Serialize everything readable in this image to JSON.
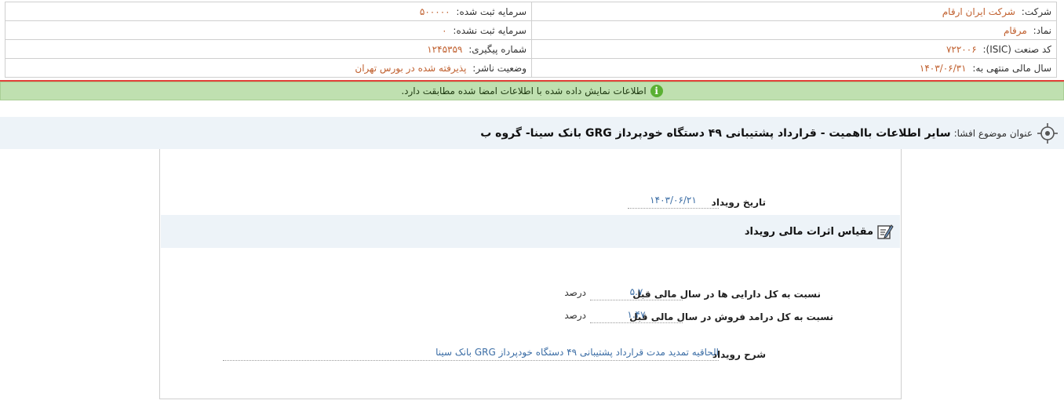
{
  "company_info": {
    "rows": [
      {
        "left_label": "سرمایه ثبت شده:",
        "left_value": "۵۰۰۰۰۰",
        "right_label": "شرکت:",
        "right_value": "شرکت ایران ارقام"
      },
      {
        "left_label": "سرمایه ثبت نشده:",
        "left_value": "۰",
        "right_label": "نماد:",
        "right_value": "مرقام"
      },
      {
        "left_label": "شماره پیگیری:",
        "left_value": "۱۲۴۵۳۵۹",
        "right_label": "کد صنعت (ISIC):",
        "right_value": "۷۲۲۰۰۶"
      },
      {
        "left_label": "وضعیت ناشر:",
        "left_value": "پذیرفته شده در بورس تهران",
        "right_label": "سال مالی منتهی به:",
        "right_value": "۱۴۰۳/۰۶/۳۱"
      }
    ]
  },
  "banner": {
    "text": "اطلاعات نمایش داده شده با اطلاعات امضا شده مطابقت دارد.",
    "icon_glyph": "i",
    "icon": "info-icon",
    "color": "#bfe0b0"
  },
  "title": {
    "label": "عنوان موضوع افشا:",
    "value": "سایر اطلاعات بااهمیت - قرارداد پشتیبانی ۴۹ دستگاه خودپرداز GRG بانک سینا- گروه ب",
    "icon": "target-icon"
  },
  "event": {
    "date_label": "تاریخ رویداد",
    "date_value": "۱۴۰۳/۰۶/۲۱"
  },
  "financial_section": {
    "title": "مقیاس اثرات مالی رویداد",
    "icon": "edit-icon",
    "rows": [
      {
        "label": "نسبت به کل دارایی ها در سال مالی قبل",
        "value": "۵.۷",
        "unit": "درصد"
      },
      {
        "label": "نسبت به کل درامد فروش در سال مالی قبل",
        "value": "۱.۴۷",
        "unit": "درصد"
      }
    ]
  },
  "description": {
    "label": "شرح رویداد",
    "value": "الحاقیه تمدید مدت قرارداد پشتیبانی ۴۹ دستگاه خودپرداز GRG بانک سینا"
  },
  "colors": {
    "value_orange": "#c0602f",
    "value_blue": "#3b6da5",
    "accent_red": "#e2413a"
  }
}
